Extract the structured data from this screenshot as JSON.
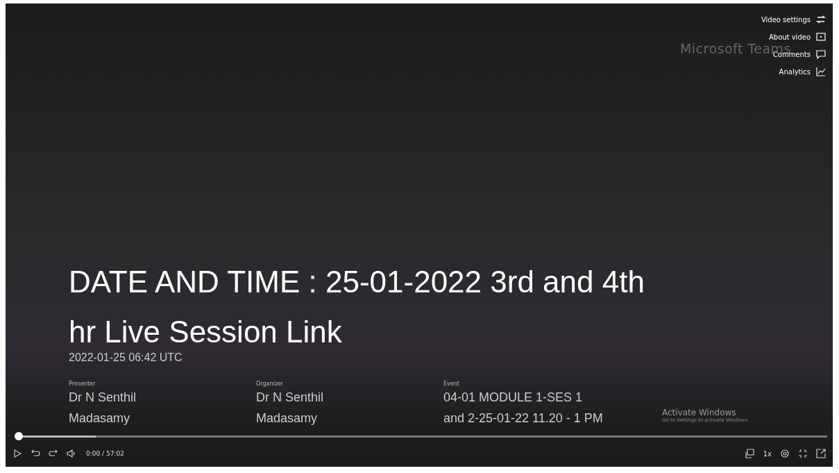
{
  "brand": "Microsoft Teams",
  "menu": [
    {
      "label": "Video settings",
      "kind": "settings"
    },
    {
      "label": "About video",
      "kind": "info"
    },
    {
      "label": "Comments",
      "kind": "comments"
    },
    {
      "label": "Analytics",
      "kind": "analytics"
    }
  ],
  "title": "DATE AND TIME : 25-01-2022 3rd and 4th hr Live Session Link",
  "date": "2022-01-25 06:42 UTC",
  "details": [
    {
      "label": "Presenter",
      "value": "Dr N Senthil Madasamy"
    },
    {
      "label": "Organizer",
      "value": "Dr N Senthil Madasamy"
    },
    {
      "label": "Event",
      "value": "04-01 MODULE 1-SES 1 and 2-25-01-22 11.20 - 1 PM"
    }
  ],
  "activation": {
    "title": "Activate Windows",
    "subtitle": "Go to Settings to activate Windows."
  },
  "progress": {
    "level": 0
  },
  "buffer": {
    "level": 0.1
  },
  "time": "0:00 / 57:02",
  "speed": "1x"
}
